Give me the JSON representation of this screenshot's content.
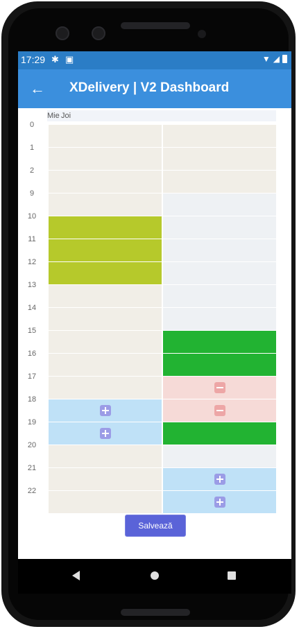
{
  "status_bar": {
    "time": "17:29",
    "icons": [
      "gear-icon",
      "camera-icon",
      "wifi-icon",
      "signal-icon",
      "battery-icon"
    ]
  },
  "app_bar": {
    "title": "XDelivery | V2 Dashboard",
    "back_icon": "arrow-back-icon"
  },
  "schedule": {
    "day_headers": [
      "Mie",
      "Joi"
    ],
    "hour_labels": [
      "0",
      "1",
      "2",
      "9",
      "10",
      "11",
      "12",
      "13",
      "14",
      "15",
      "16",
      "17",
      "18",
      "19",
      "20",
      "21",
      "22"
    ],
    "columns": [
      [
        "default",
        "default",
        "default",
        "default",
        "selected",
        "selected",
        "selected",
        "default",
        "default",
        "default",
        "default",
        "default",
        "add",
        "add",
        "default",
        "default",
        "default"
      ],
      [
        "default",
        "default",
        "default",
        "empty",
        "empty",
        "empty",
        "empty",
        "empty",
        "empty",
        "booked",
        "booked",
        "remove",
        "remove",
        "booked",
        "empty",
        "add",
        "add"
      ]
    ],
    "colors": {
      "default": "#f1eee7",
      "empty": "#eef1f4",
      "selected": "#b6c92b",
      "booked": "#22b332",
      "add": "#bfe1f7",
      "remove": "#f6dad7"
    }
  },
  "save_button": {
    "label": "Salvează"
  },
  "nav": {
    "icons": [
      "back-triangle-icon",
      "home-circle-icon",
      "recents-square-icon"
    ]
  }
}
